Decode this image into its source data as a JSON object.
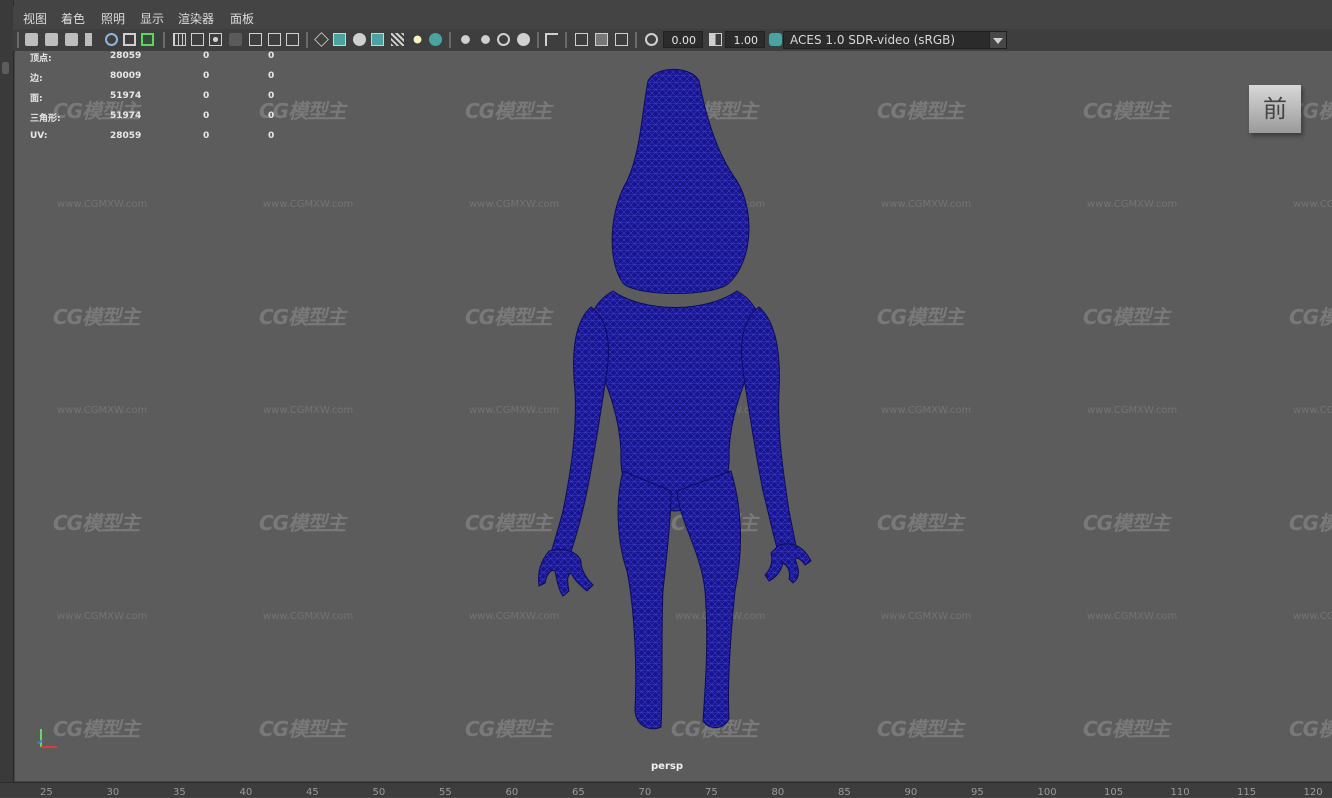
{
  "menu": [
    "视图",
    "着色",
    "照明",
    "显示",
    "渲染器",
    "面板"
  ],
  "toolbar": {
    "exposure_value": "0.00",
    "gamma_value": "1.00",
    "color_space": "ACES 1.0 SDR-video (sRGB)"
  },
  "hud": {
    "rows": [
      {
        "label": "顶点:",
        "total": "28059",
        "selected": "0",
        "other": "0"
      },
      {
        "label": "边:",
        "total": "80009",
        "selected": "0",
        "other": "0"
      },
      {
        "label": "面:",
        "total": "51974",
        "selected": "0",
        "other": "0"
      },
      {
        "label": "三角形:",
        "total": "51974",
        "selected": "0",
        "other": "0"
      },
      {
        "label": "UV:",
        "total": "28059",
        "selected": "0",
        "other": "0"
      }
    ]
  },
  "view_cube_label": "前",
  "camera_label": "persp",
  "watermark": {
    "logo": "CG模型主",
    "url": "www.CGMXW.com"
  },
  "timeline_ticks": [
    "25",
    "30",
    "35",
    "40",
    "45",
    "50",
    "55",
    "60",
    "65",
    "70",
    "75",
    "80",
    "85",
    "90",
    "95",
    "100",
    "105",
    "110",
    "115",
    "120"
  ],
  "colors": {
    "mesh": "#17158c",
    "mesh_line": "#3b39c8",
    "viewport": "#5c5c5c",
    "ui": "#444444",
    "accent_active": "#4aa3a0"
  }
}
